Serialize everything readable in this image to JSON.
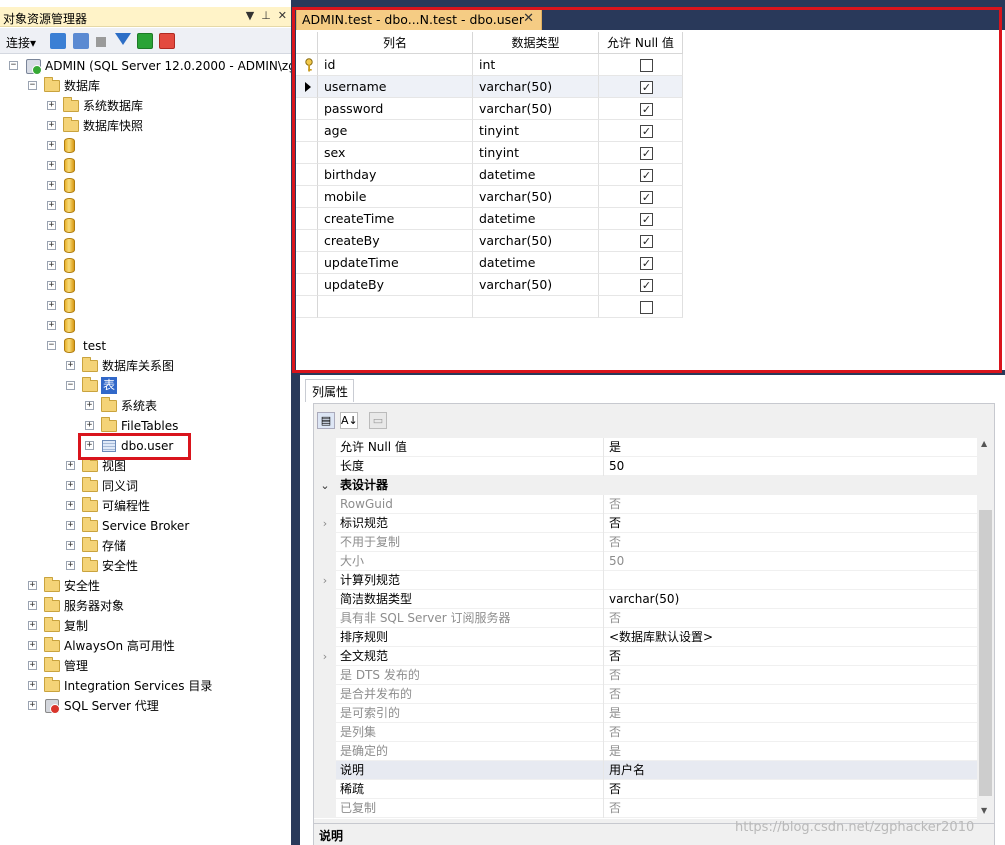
{
  "object_explorer": {
    "title": "对象资源管理器",
    "title_buttons": [
      "▼",
      "⊥",
      "✕"
    ],
    "toolbar": {
      "connect_label": "连接▾"
    },
    "tree": {
      "server": "ADMIN (SQL Server 12.0.2000 - ADMIN\\zg",
      "databases": "数据库",
      "system_databases": "系统数据库",
      "snapshots": "数据库快照",
      "test_db": "test",
      "db_diagrams": "数据库关系图",
      "tables": "表",
      "system_tables": "系统表",
      "filetables": "FileTables",
      "dbo_user": "dbo.user",
      "views": "视图",
      "synonyms": "同义词",
      "programmability": "可编程性",
      "service_broker": "Service Broker",
      "storage": "存储",
      "db_security": "安全性",
      "security": "安全性",
      "server_objects": "服务器对象",
      "replication": "复制",
      "alwayson": "AlwaysOn 高可用性",
      "management": "管理",
      "integration_services": "Integration Services 目录",
      "agent": "SQL Server 代理"
    }
  },
  "document_tab": {
    "title": "ADMIN.test - dbo...N.test - dbo.user",
    "close": "✕"
  },
  "designer": {
    "headers": {
      "col_name": "列名",
      "data_type": "数据类型",
      "allow_null": "允许 Null 值"
    },
    "rows": [
      {
        "name": "id",
        "type": "int",
        "nullable": "",
        "key": true
      },
      {
        "name": "username",
        "type": "varchar(50)",
        "nullable": "✓",
        "current": true
      },
      {
        "name": "password",
        "type": "varchar(50)",
        "nullable": "✓"
      },
      {
        "name": "age",
        "type": "tinyint",
        "nullable": "✓"
      },
      {
        "name": "sex",
        "type": "tinyint",
        "nullable": "✓"
      },
      {
        "name": "birthday",
        "type": "datetime",
        "nullable": "✓"
      },
      {
        "name": "mobile",
        "type": "varchar(50)",
        "nullable": "✓"
      },
      {
        "name": "createTime",
        "type": "datetime",
        "nullable": "✓"
      },
      {
        "name": "createBy",
        "type": "varchar(50)",
        "nullable": "✓"
      },
      {
        "name": "updateTime",
        "type": "datetime",
        "nullable": "✓"
      },
      {
        "name": "updateBy",
        "type": "varchar(50)",
        "nullable": "✓"
      },
      {
        "name": "",
        "type": "",
        "nullable": ""
      }
    ]
  },
  "properties": {
    "tab_label": "列属性",
    "rows": [
      {
        "name": "允许 Null 值",
        "value": "是"
      },
      {
        "name": "长度",
        "value": "50"
      },
      {
        "name": "表设计器",
        "value": "",
        "category": true
      },
      {
        "name": "RowGuid",
        "value": "否",
        "dim": true
      },
      {
        "name": "标识规范",
        "value": "否",
        "expand": true
      },
      {
        "name": "不用于复制",
        "value": "否",
        "dim": true
      },
      {
        "name": "大小",
        "value": "50",
        "dim": true
      },
      {
        "name": "计算列规范",
        "value": "",
        "expand": true
      },
      {
        "name": "简洁数据类型",
        "value": "varchar(50)"
      },
      {
        "name": "具有非 SQL Server 订阅服务器",
        "value": "否",
        "dim": true
      },
      {
        "name": "排序规则",
        "value": "<数据库默认设置>"
      },
      {
        "name": "全文规范",
        "value": "否",
        "expand": true
      },
      {
        "name": "是 DTS 发布的",
        "value": "否",
        "dim": true
      },
      {
        "name": "是合并发布的",
        "value": "否",
        "dim": true
      },
      {
        "name": "是可索引的",
        "value": "是",
        "dim": true
      },
      {
        "name": "是列集",
        "value": "否",
        "dim": true
      },
      {
        "name": "是确定的",
        "value": "是",
        "dim": true
      },
      {
        "name": "说明",
        "value": "用户名"
      },
      {
        "name": "稀疏",
        "value": "否"
      },
      {
        "name": "已复制",
        "value": "否",
        "dim": true
      }
    ],
    "description_label": "说明",
    "scroll_up": "▲",
    "scroll_down": "▼",
    "category_chevron": "⌄",
    "expand_chevron": "›",
    "toolbar_icons": [
      "categorized-icon",
      "az-sort-icon",
      "property-pages-icon"
    ]
  },
  "watermark": "https://blog.csdn.net/zgphacker2010",
  "colors": {
    "highlight_red": "#d9141c",
    "tab_gold": "#f5cc84",
    "frame_navy": "#29395a"
  }
}
